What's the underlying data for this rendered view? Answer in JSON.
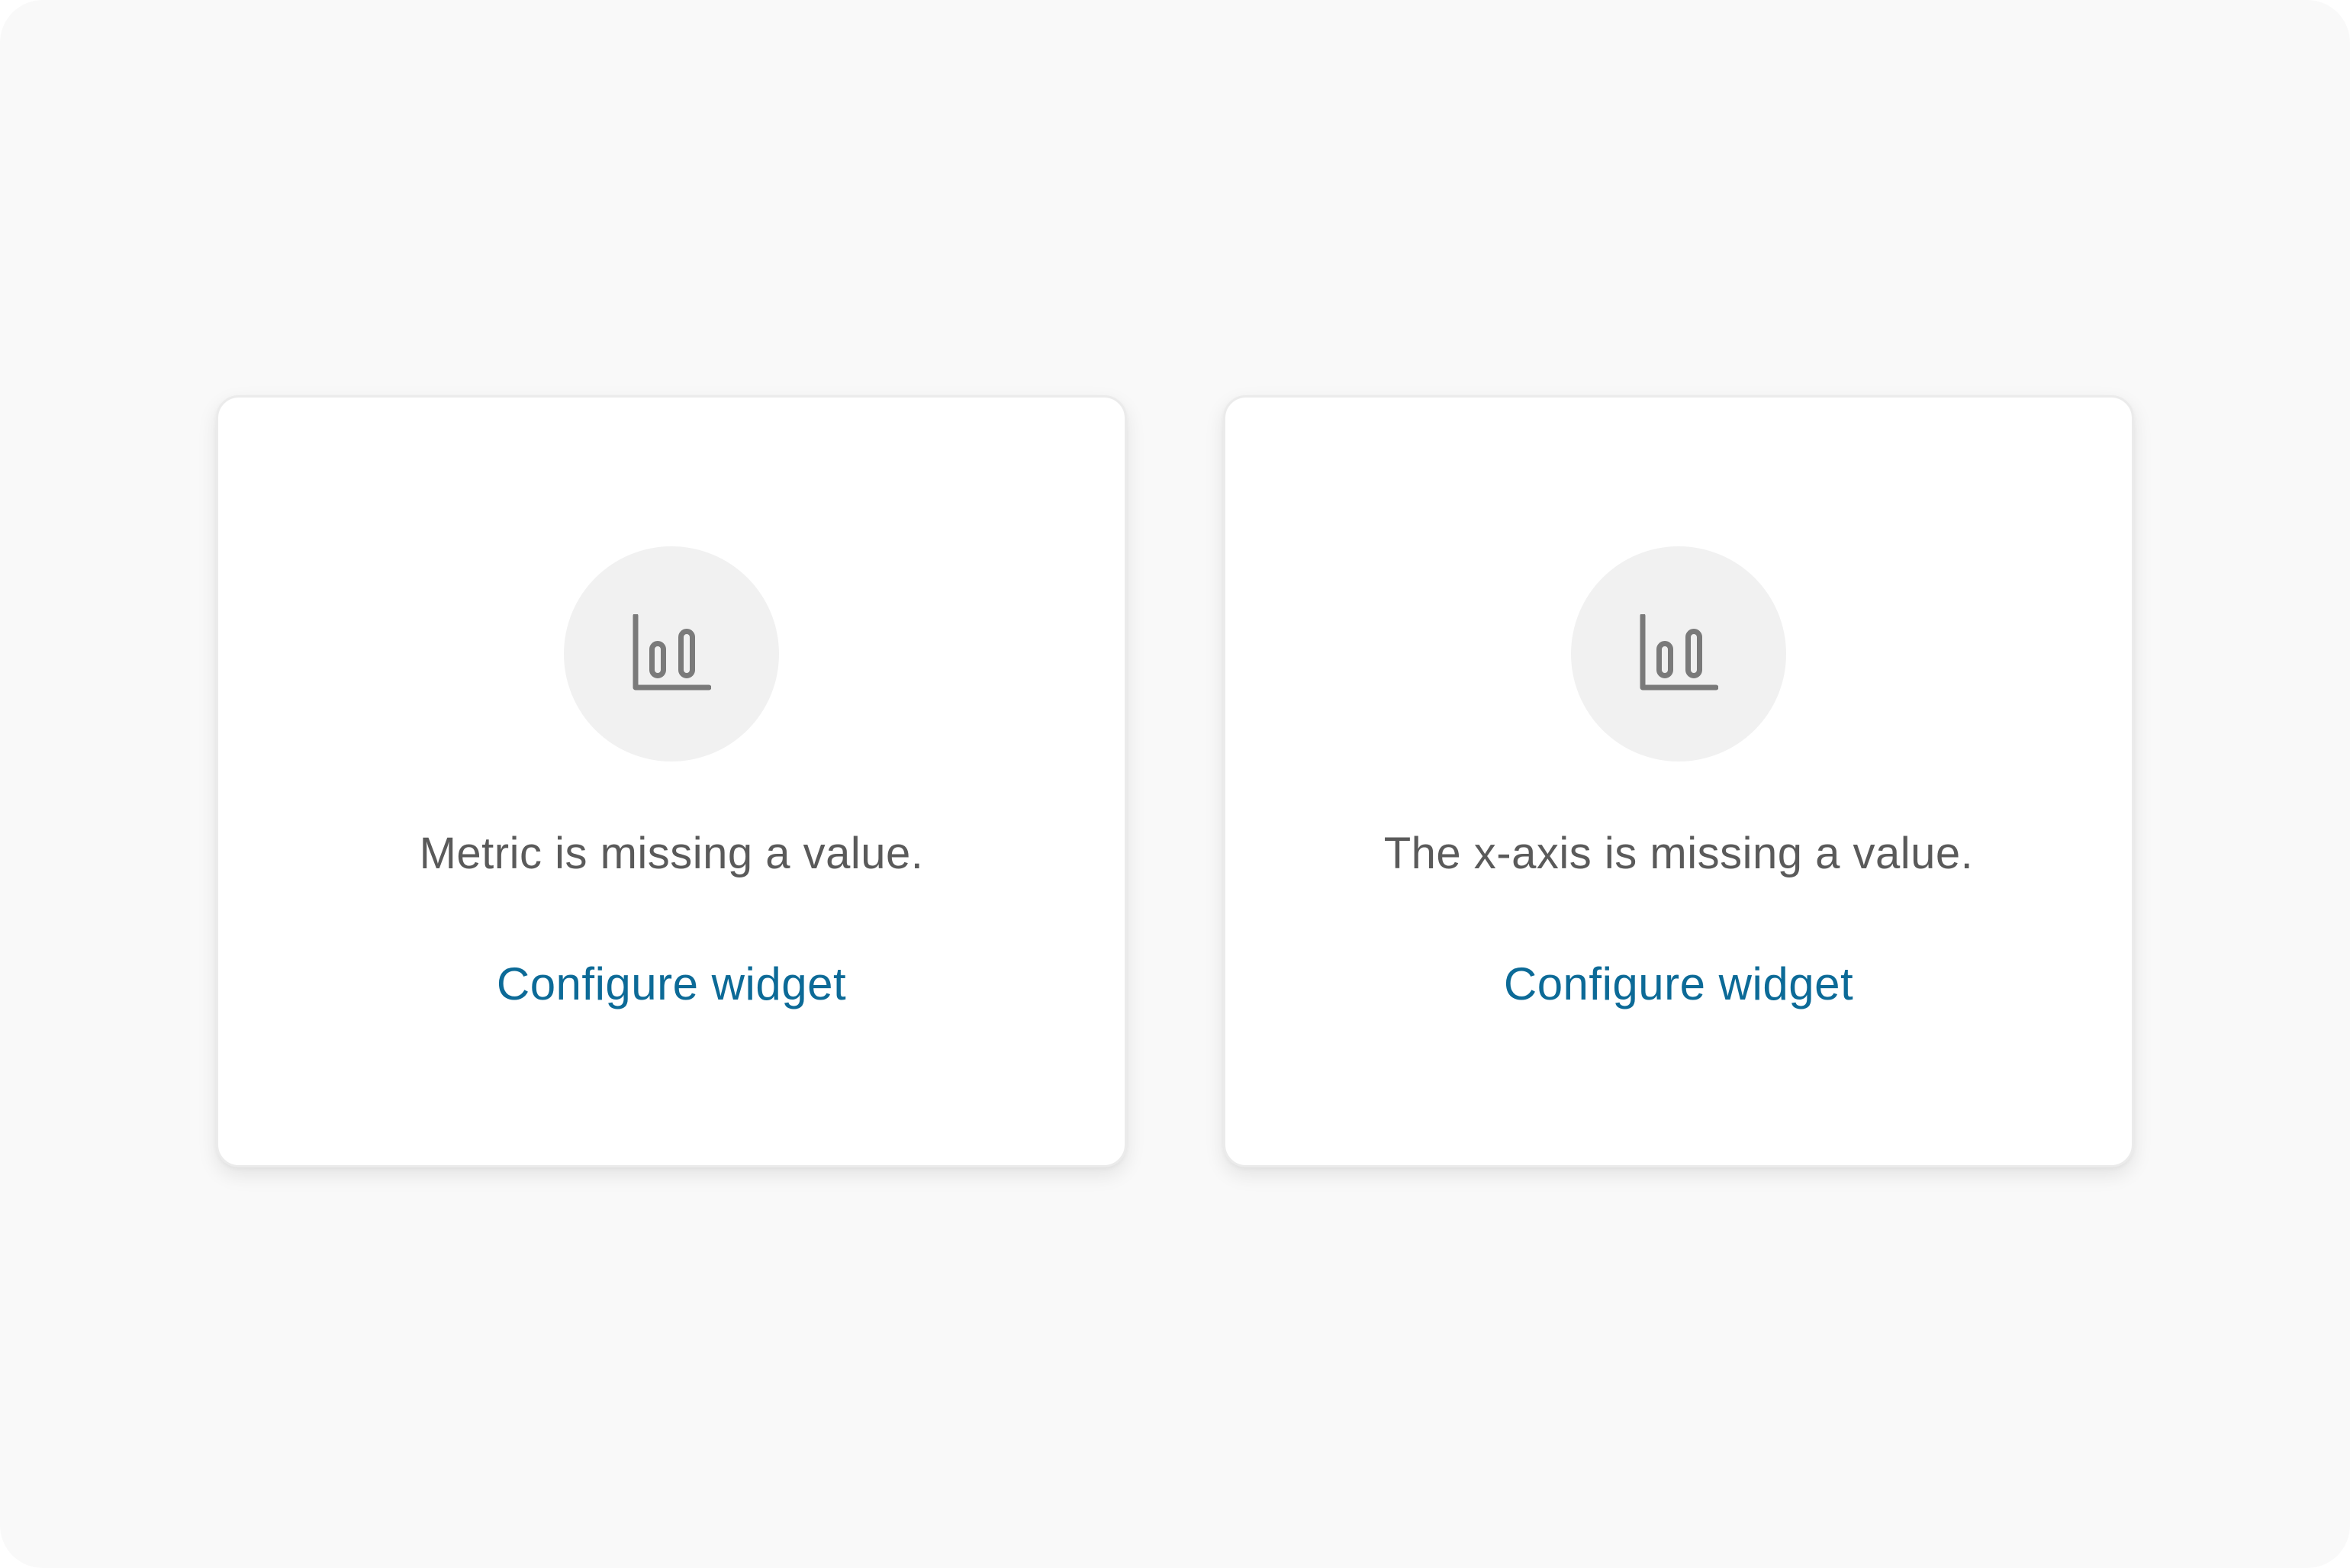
{
  "widgets": [
    {
      "icon": "bar-chart-icon",
      "message": "Metric is missing a value.",
      "action_label": "Configure widget"
    },
    {
      "icon": "bar-chart-icon",
      "message": "The x-axis is missing a value.",
      "action_label": "Configure widget"
    }
  ],
  "colors": {
    "background": "#f9f9f9",
    "card": "#ffffff",
    "icon": "#7a7a7a",
    "icon_background": "#f1f1f1",
    "message_text": "#5a5a5a",
    "link": "#0c6a97"
  }
}
